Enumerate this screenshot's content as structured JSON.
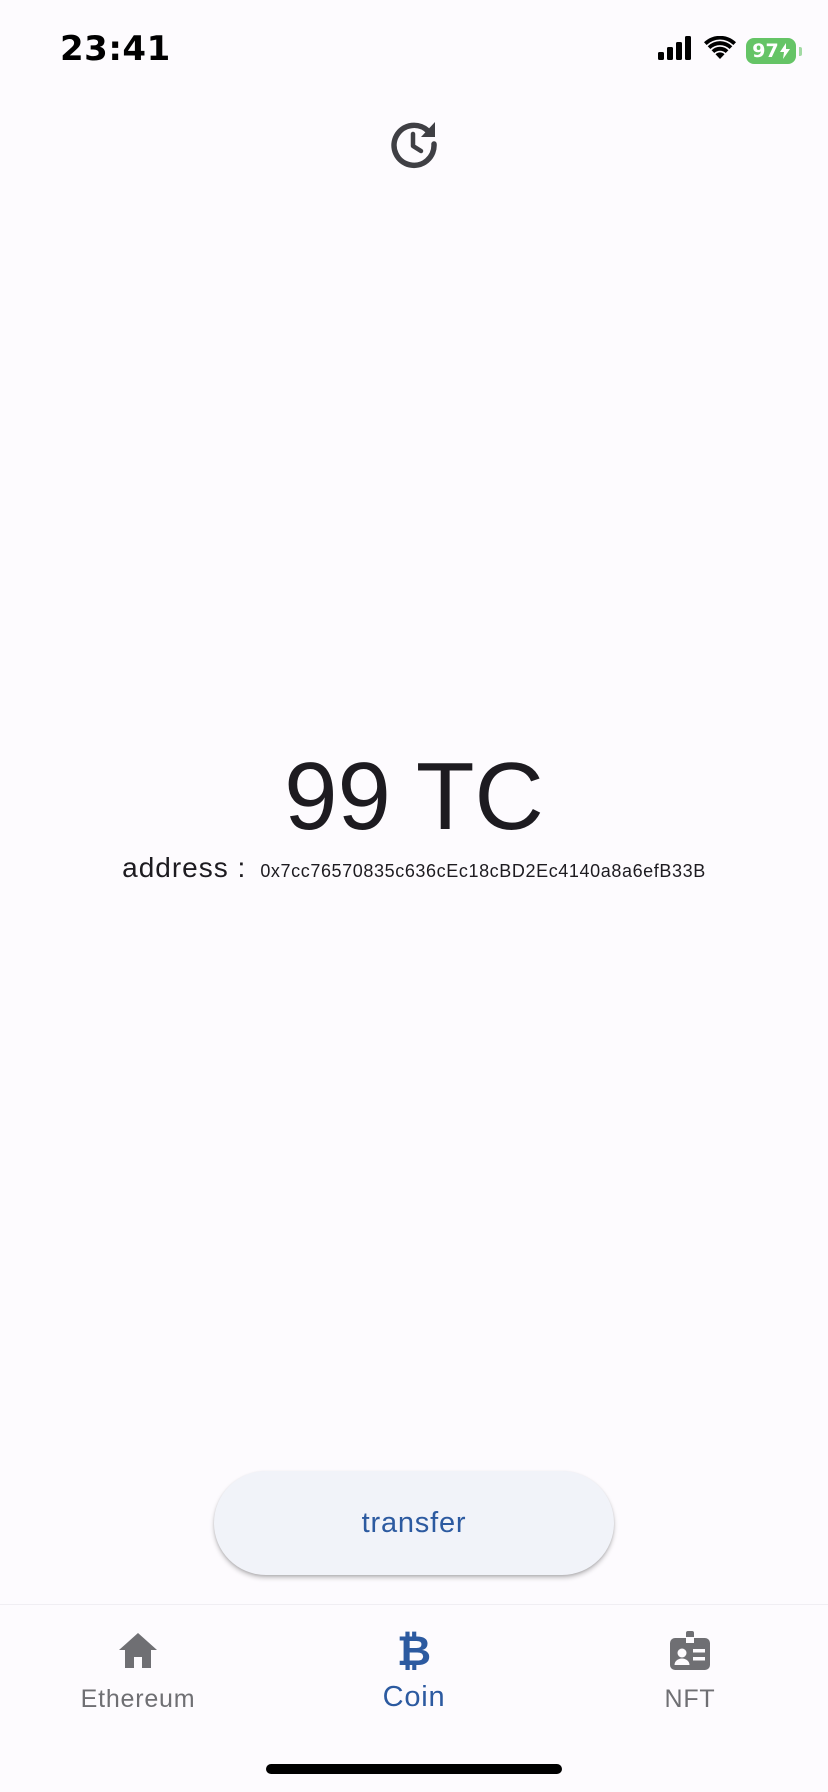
{
  "status_bar": {
    "time": "23:41",
    "battery_level": "97",
    "icons": [
      "cellular-signal-icon",
      "wifi-icon",
      "battery-charging-icon"
    ]
  },
  "toolbar": {
    "history_icon": "history-icon"
  },
  "wallet": {
    "balance": "99 TC",
    "address_label": "address :",
    "address_value": "0x7cc76570835c636cEc18cBD2Ec4140a8a6efB33B"
  },
  "actions": {
    "transfer_label": "transfer"
  },
  "bottom_nav": {
    "items": [
      {
        "label": "Ethereum",
        "icon": "home-icon",
        "active": false
      },
      {
        "label": "Coin",
        "icon": "bitcoin-icon",
        "active": true
      },
      {
        "label": "NFT",
        "icon": "badge-icon",
        "active": false
      }
    ]
  },
  "colors": {
    "background": "#fdfbfe",
    "accent": "#2c5aa0",
    "inactive": "#6f6f73",
    "battery": "#65c466",
    "button_bg": "#f1f3f9"
  }
}
